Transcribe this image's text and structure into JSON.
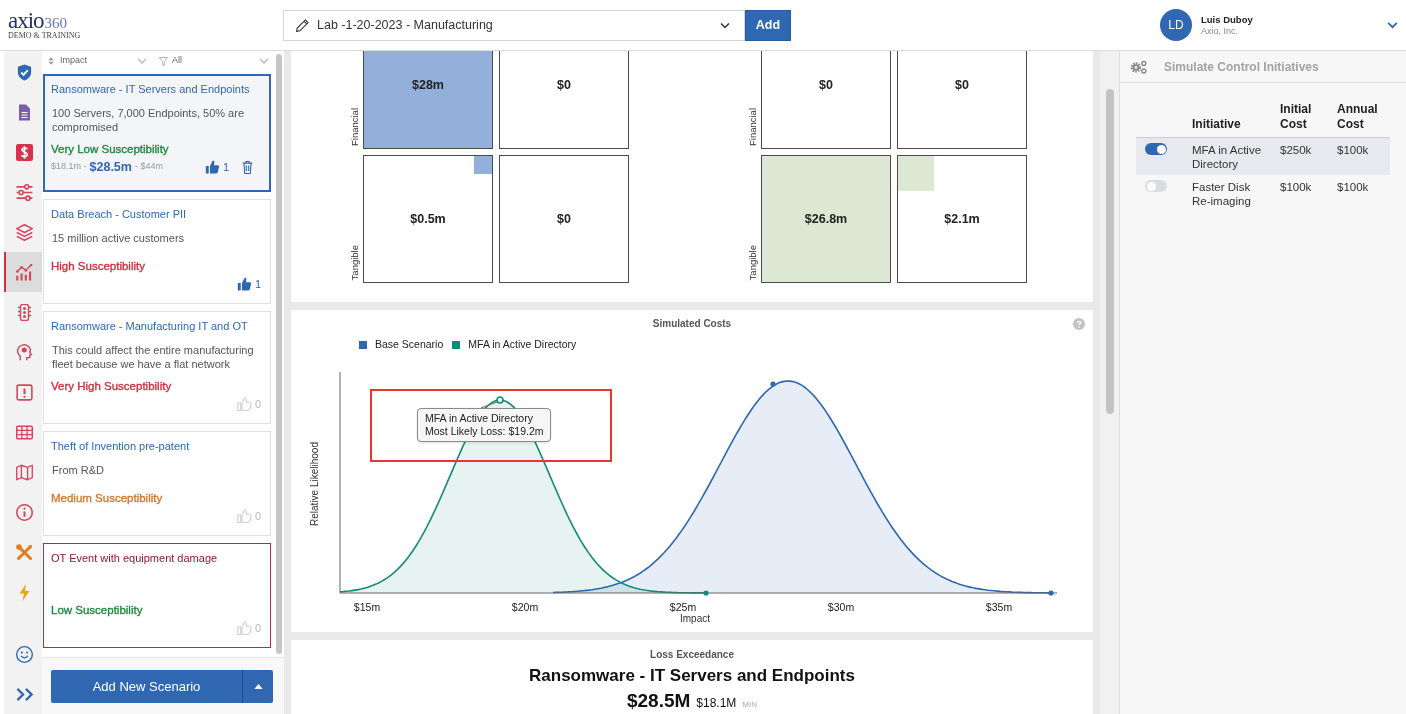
{
  "header": {
    "logo": {
      "wordmark": "axio",
      "number": "360",
      "tagline": "DEMO & TRAINING"
    },
    "assessment": "Lab -1-20-2023 - Manufacturing",
    "add_button": "Add",
    "user": {
      "initials": "LD",
      "name": "Luis Duboy",
      "company": "Axio, Inc."
    }
  },
  "nav_top": [
    {
      "selected": false
    },
    {
      "selected": false
    },
    {
      "selected": false
    },
    {
      "selected": false
    },
    {
      "selected": false
    },
    {
      "selected": true
    },
    {
      "selected": false
    },
    {
      "selected": false
    },
    {
      "selected": false
    },
    {
      "selected": false
    },
    {
      "selected": false
    },
    {
      "selected": false
    },
    {
      "selected": false
    },
    {
      "selected": false
    }
  ],
  "nav_bottom": [
    {
      "selected": false
    },
    {
      "selected": false
    }
  ],
  "scenario_list": {
    "sort": "Impact",
    "filter": "All",
    "scenarios": [
      {
        "title": "Ransomware - IT Servers and Endpoints",
        "description": "100 Servers, 7,000 Endpoints, 50% are compromised",
        "susceptibility": "Very Low Susceptibility",
        "color": "#1e8a3c",
        "range": {
          "min": "$18.1m -",
          "likely": "$28.5m",
          "max": "- $44m"
        },
        "votes": "1",
        "voted": true,
        "selected": true,
        "alert": false
      },
      {
        "title": "Data Breach - Customer PII",
        "description": "15 million active customers",
        "susceptibility": "High Susceptibility",
        "color": "#d12f3f",
        "votes": "1",
        "voted": true,
        "selected": false,
        "alert": false
      },
      {
        "title": "Ransomware - Manufacturing IT and OT",
        "description": "This could affect the entire manufacturing fleet because we have a flat network",
        "susceptibility": "Very High Susceptibility",
        "color": "#d12f3f",
        "votes": "0",
        "voted": false,
        "selected": false,
        "alert": false
      },
      {
        "title": "Theft of Invention pre-patent",
        "description": "From R&D",
        "susceptibility": "Medium Susceptibility",
        "color": "#d2782a",
        "votes": "0",
        "voted": false,
        "selected": false,
        "alert": false
      },
      {
        "title": "OT Event with equipment damage",
        "susceptibility": "Low Susceptibility",
        "color": "#1e8a3c",
        "votes": "0",
        "voted": false,
        "selected": false,
        "alert": true
      }
    ],
    "add_button": "Add New Scenario"
  },
  "impact_grids": [
    {
      "color": "#93b0da",
      "rows": [
        {
          "label": "Financial",
          "cells": [
            {
              "value": "$28m",
              "level": 1
            },
            {
              "value": "$0"
            }
          ]
        },
        {
          "label": "Tangible",
          "cells": [
            {
              "value": "$0.5m",
              "level": 0.14
            },
            {
              "value": "$0"
            }
          ]
        }
      ]
    },
    {
      "color": "#dce8d3",
      "rows": [
        {
          "label": "Financial",
          "cells": [
            {
              "value": "$0"
            },
            {
              "value": "$0"
            }
          ]
        },
        {
          "label": "Tangible",
          "cells": [
            {
              "value": "$26.8m",
              "level": 1
            },
            {
              "value": "$2.1m",
              "level": 0.28
            }
          ]
        }
      ]
    }
  ],
  "simulated_costs": {
    "title": "Simulated Costs",
    "legend": [
      {
        "label": "Base Scenario",
        "color": "#2f67b2"
      },
      {
        "label": "MFA in Active Directory",
        "color": "#148a7a"
      }
    ],
    "y_axis_label": "Relative Likelihood",
    "x_axis_label": "Impact",
    "x_ticks": [
      "$15m",
      "$20m",
      "$25m",
      "$30m",
      "$35m"
    ],
    "tooltip": {
      "series": "MFA in Active Directory",
      "value": "Most Likely Loss: $19.2m"
    }
  },
  "loss_exceedance": {
    "title": "Loss Exceedance",
    "scenario": "Ransomware - IT Servers and Endpoints",
    "likely": "$28.5M",
    "min": "$18.1M",
    "min_label": "MIN"
  },
  "initiatives_panel": {
    "title": "Simulate Control Initiatives",
    "columns": [
      "Initiative",
      "Initial Cost",
      "Annual Cost"
    ],
    "rows": [
      {
        "on": true,
        "selected": true,
        "name": "MFA in Active Directory",
        "initial_cost": "$250k",
        "annual_cost": "$100k"
      },
      {
        "on": false,
        "selected": false,
        "name": "Faster Disk Re-imaging",
        "initial_cost": "$100k",
        "annual_cost": "$100k"
      }
    ]
  }
}
